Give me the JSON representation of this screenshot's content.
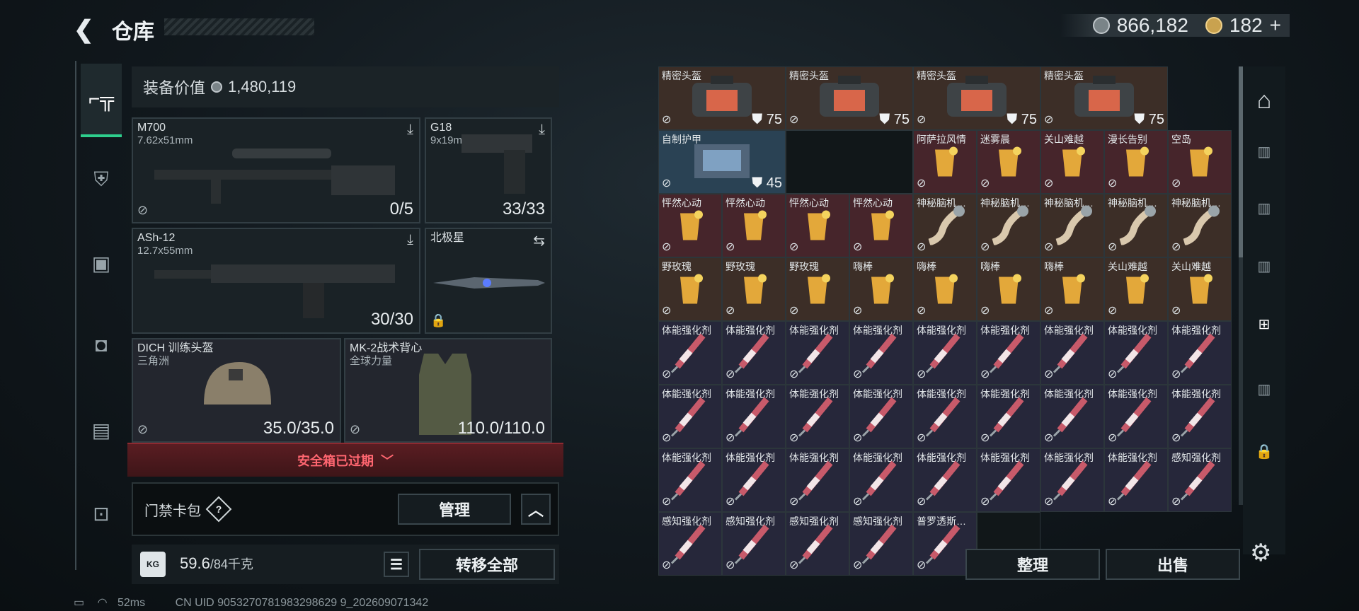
{
  "header": {
    "back": "<",
    "title": "仓库",
    "silver": "866,182",
    "gold": "182",
    "gold_plus": "+"
  },
  "leftnav": {
    "items": [
      "pistol-icon",
      "armor-icon",
      "backpack-icon",
      "bag-icon",
      "case-icon",
      "toolbox-icon"
    ]
  },
  "equip": {
    "label": "装备价值",
    "value": "1,480,119",
    "slots": [
      {
        "name": "M700",
        "sub": "7.62x51mm",
        "amount": "0/5"
      },
      {
        "name": "G18",
        "sub": "9x19mm",
        "amount": "33/33"
      },
      {
        "name": "ASh-12",
        "sub": "12.7x55mm",
        "amount": "30/30"
      },
      {
        "name": "北极星",
        "sub": "",
        "amount": ""
      },
      {
        "name": "DICH 训练头盔",
        "sub": "三角洲",
        "amount": "35.0/35.0"
      },
      {
        "name": "MK-2战术背心",
        "sub": "全球力量",
        "amount": "110.0/110.0"
      }
    ],
    "expired": "安全箱已过期",
    "keybag": "门禁卡包",
    "help": "?",
    "manage": "管理",
    "weight": "59.6",
    "weight_max": "/84千克",
    "transfer": "转移全部"
  },
  "status": {
    "ping": "52ms",
    "uid": "CN UID 9053270781983298629 9_202609071342"
  },
  "grid": {
    "items": [
      {
        "name": "精密头盔",
        "dur": "75",
        "type": "bag",
        "span": 2,
        "bg": "brown"
      },
      {
        "name": "精密头盔",
        "dur": "75",
        "type": "bag",
        "span": 2,
        "bg": "brown"
      },
      {
        "name": "精密头盔",
        "dur": "75",
        "type": "bag",
        "span": 2,
        "bg": "brown"
      },
      {
        "name": "精密头盔",
        "dur": "75",
        "type": "bag",
        "span": 2,
        "bg": "brown"
      },
      {
        "name": "自制护甲",
        "dur": "45",
        "type": "armor",
        "span": 2,
        "bg": "blue"
      },
      {
        "name": "",
        "dur": "",
        "type": "empty",
        "span": 2,
        "bg": "empty"
      },
      {
        "name": "阿萨拉风情",
        "type": "drink",
        "bg": "red"
      },
      {
        "name": "迷雾晨",
        "type": "drink",
        "bg": "red"
      },
      {
        "name": "关山难越",
        "type": "drink",
        "bg": "red"
      },
      {
        "name": "漫长告别",
        "type": "drink",
        "bg": "red"
      },
      {
        "name": "空岛",
        "type": "drink",
        "bg": "red"
      },
      {
        "name": "怦然心动",
        "type": "drink",
        "bg": "red"
      },
      {
        "name": "怦然心动",
        "type": "drink",
        "bg": "red"
      },
      {
        "name": "怦然心动",
        "type": "drink",
        "bg": "red"
      },
      {
        "name": "怦然心动",
        "type": "drink",
        "bg": "red"
      },
      {
        "name": "神秘脑机…",
        "type": "horn",
        "bg": "brown"
      },
      {
        "name": "神秘脑机…",
        "type": "horn",
        "bg": "brown"
      },
      {
        "name": "神秘脑机…",
        "type": "horn",
        "bg": "brown"
      },
      {
        "name": "神秘脑机…",
        "type": "horn",
        "bg": "brown"
      },
      {
        "name": "神秘脑机…",
        "type": "horn",
        "bg": "brown"
      },
      {
        "name": "野玫瑰",
        "type": "drink",
        "bg": "brown"
      },
      {
        "name": "野玫瑰",
        "type": "drink",
        "bg": "brown"
      },
      {
        "name": "野玫瑰",
        "type": "drink",
        "bg": "brown"
      },
      {
        "name": "嗨棒",
        "type": "drink",
        "bg": "brown"
      },
      {
        "name": "嗨棒",
        "type": "drink",
        "bg": "brown"
      },
      {
        "name": "嗨棒",
        "type": "drink",
        "bg": "brown"
      },
      {
        "name": "嗨棒",
        "type": "drink",
        "bg": "brown"
      },
      {
        "name": "关山难越",
        "type": "drink",
        "bg": "brown"
      },
      {
        "name": "关山难越",
        "type": "drink",
        "bg": "brown"
      },
      {
        "name": "体能强化剂",
        "type": "syringe",
        "bg": "purple"
      },
      {
        "name": "体能强化剂",
        "type": "syringe",
        "bg": "purple"
      },
      {
        "name": "体能强化剂",
        "type": "syringe",
        "bg": "purple"
      },
      {
        "name": "体能强化剂",
        "type": "syringe",
        "bg": "purple"
      },
      {
        "name": "体能强化剂",
        "type": "syringe",
        "bg": "purple"
      },
      {
        "name": "体能强化剂",
        "type": "syringe",
        "bg": "purple"
      },
      {
        "name": "体能强化剂",
        "type": "syringe",
        "bg": "purple"
      },
      {
        "name": "体能强化剂",
        "type": "syringe",
        "bg": "purple"
      },
      {
        "name": "体能强化剂",
        "type": "syringe",
        "bg": "purple"
      },
      {
        "name": "体能强化剂",
        "type": "syringe",
        "bg": "purple"
      },
      {
        "name": "体能强化剂",
        "type": "syringe",
        "bg": "purple"
      },
      {
        "name": "体能强化剂",
        "type": "syringe",
        "bg": "purple"
      },
      {
        "name": "体能强化剂",
        "type": "syringe",
        "bg": "purple"
      },
      {
        "name": "体能强化剂",
        "type": "syringe",
        "bg": "purple"
      },
      {
        "name": "体能强化剂",
        "type": "syringe",
        "bg": "purple"
      },
      {
        "name": "体能强化剂",
        "type": "syringe",
        "bg": "purple"
      },
      {
        "name": "体能强化剂",
        "type": "syringe",
        "bg": "purple"
      },
      {
        "name": "体能强化剂",
        "type": "syringe",
        "bg": "purple"
      },
      {
        "name": "体能强化剂",
        "type": "syringe",
        "bg": "purple"
      },
      {
        "name": "体能强化剂",
        "type": "syringe",
        "bg": "purple"
      },
      {
        "name": "体能强化剂",
        "type": "syringe",
        "bg": "purple"
      },
      {
        "name": "体能强化剂",
        "type": "syringe",
        "bg": "purple"
      },
      {
        "name": "体能强化剂",
        "type": "syringe",
        "bg": "purple"
      },
      {
        "name": "体能强化剂",
        "type": "syringe",
        "bg": "purple"
      },
      {
        "name": "体能强化剂",
        "type": "syringe",
        "bg": "purple"
      },
      {
        "name": "体能强化剂",
        "type": "syringe",
        "bg": "purple"
      },
      {
        "name": "感知强化剂",
        "type": "syringe",
        "bg": "purple"
      },
      {
        "name": "感知强化剂",
        "type": "syringe",
        "bg": "purple"
      },
      {
        "name": "感知强化剂",
        "type": "syringe",
        "bg": "purple"
      },
      {
        "name": "感知强化剂",
        "type": "syringe",
        "bg": "purple"
      },
      {
        "name": "感知强化剂",
        "type": "syringe",
        "bg": "purple"
      },
      {
        "name": "普罗透斯…",
        "type": "syringe",
        "bg": "purple"
      },
      {
        "name": "",
        "type": "empty",
        "bg": "empty"
      }
    ],
    "sort": "整理",
    "sell": "出售"
  }
}
